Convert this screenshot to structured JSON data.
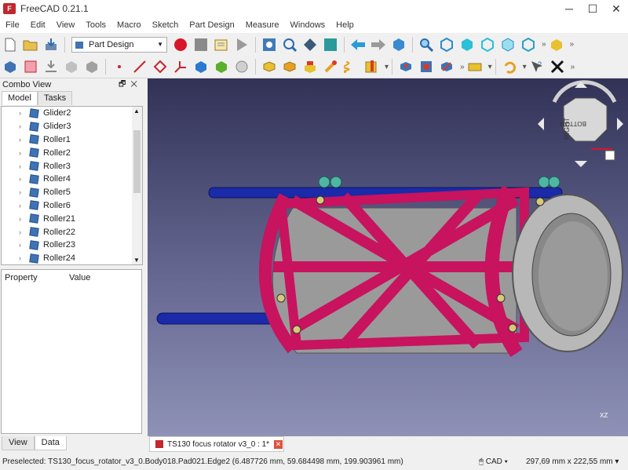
{
  "window": {
    "title": "FreeCAD 0.21.1",
    "app_icon": "freecad-logo-icon",
    "controls": [
      "─",
      "☐",
      "✕"
    ]
  },
  "menubar": [
    "File",
    "Edit",
    "View",
    "Tools",
    "Macro",
    "Sketch",
    "Part Design",
    "Measure",
    "Windows",
    "Help"
  ],
  "workbench_selector": {
    "value": "Part Design"
  },
  "combo_view": {
    "title": "Combo View",
    "tabs": [
      "Model",
      "Tasks"
    ],
    "tree_items": [
      "Glider2",
      "Glider3",
      "Roller1",
      "Roller2",
      "Roller3",
      "Roller4",
      "Roller5",
      "Roller6",
      "Roller21",
      "Roller22",
      "Roller23",
      "Roller24"
    ],
    "property_headers": [
      "Property",
      "Value"
    ],
    "bottom_tabs": [
      "View",
      "Data"
    ]
  },
  "document_tab": {
    "label": "TS130 focus rotator v3_0 : 1*"
  },
  "navcube": {
    "face_right": "RIGHT",
    "face_bottom": "BOTTOM"
  },
  "axis_label": "XZ",
  "statusbar": {
    "message": "Preselected: TS130_focus_rotator_v3_0.Body018.Pad021.Edge2 (6.487726 mm, 59.684498 mm, 199.903961 mm)",
    "nav_style": "CAD",
    "dimensions": "297,69 mm x 222,55 mm"
  },
  "colors": {
    "frame": "#c8135e",
    "rod": "#1a2aa8",
    "tube": "#9a9a9a",
    "ring": "#b8b8b8",
    "bolt": "#d8c87a",
    "knob": "#4fb6a5",
    "bg_top": "#323257",
    "bg_bottom": "#8f92b6"
  }
}
